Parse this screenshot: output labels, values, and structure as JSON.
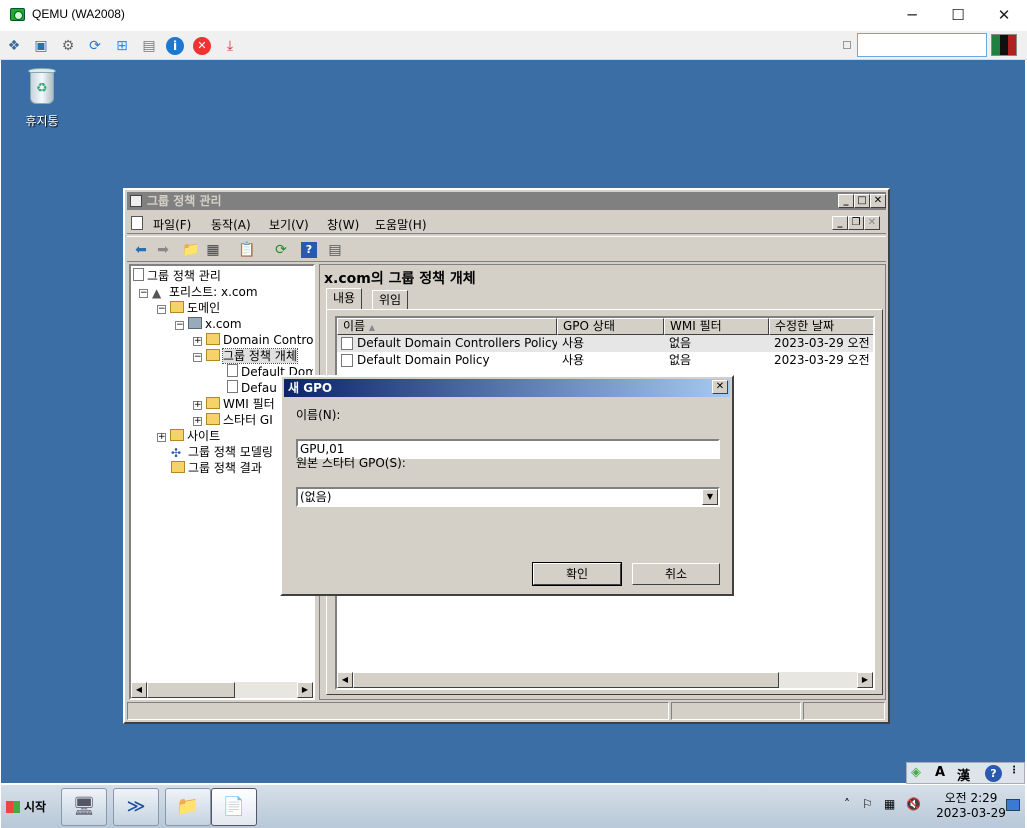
{
  "host": {
    "title": "QEMU (WA2008)",
    "controls": {
      "minimize": "─",
      "maximize": "☐",
      "close": "✕"
    },
    "toolbar_icons": [
      "vm-icon",
      "fullscreen-icon",
      "settings-icon",
      "refresh-icon",
      "windows-icon",
      "usb-icon",
      "info-icon",
      "stop-icon",
      "save-icon"
    ],
    "search_value": ""
  },
  "desktop": {
    "recycle_bin_label": "휴지통"
  },
  "gpmc": {
    "title": "그룹 정책 관리",
    "menu": [
      "파일(F)",
      "동작(A)",
      "보기(V)",
      "창(W)",
      "도움말(H)"
    ],
    "tree": {
      "root": "그룹 정책 관리",
      "forest": "포리스트: x.com",
      "domains": "도메인",
      "domain": "x.com",
      "dc_ou": "Domain Contro",
      "gpo_container": "그룹 정책 개체",
      "gpo1": "Default Dom",
      "gpo2": "Defau",
      "wmi": "WMI 필터",
      "starter": "스타터 GI",
      "sites": "사이트",
      "modeling": "그룹 정책 모델링",
      "results": "그룹 정책 결과"
    },
    "pane_title": "x.com의 그룹 정책 개체",
    "tabs": [
      "내용",
      "위임"
    ],
    "columns": [
      "이름",
      "GPO 상태",
      "WMI 필터",
      "수정한 날짜"
    ],
    "rows": [
      {
        "name": "Default Domain Controllers Policy",
        "status": "사용",
        "wmi": "없음",
        "modified": "2023-03-29 오전 ..."
      },
      {
        "name": "Default Domain Policy",
        "status": "사용",
        "wmi": "없음",
        "modified": "2023-03-29 오전 ..."
      }
    ]
  },
  "dialog": {
    "title": "새 GPO",
    "name_label": "이름(N):",
    "name_value": "GPU,01",
    "starter_label": "원본 스타터 GPO(S):",
    "starter_value": "(없음)",
    "ok": "확인",
    "cancel": "취소"
  },
  "langbar": {
    "ime": "A",
    "hanja": "漢",
    "help": "?"
  },
  "taskbar": {
    "start": "시작",
    "clock_time": "오전 2:29",
    "clock_date": "2023-03-29"
  }
}
